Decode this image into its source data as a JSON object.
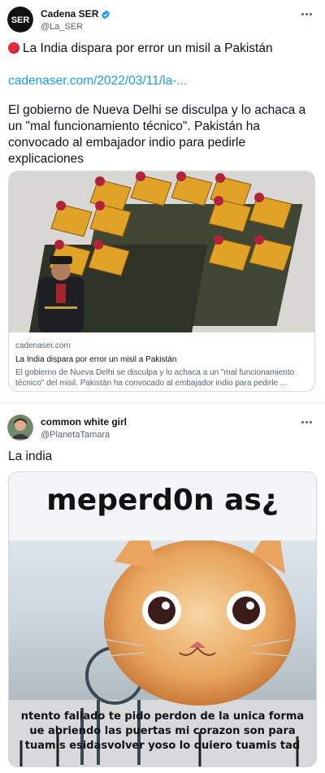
{
  "tweet1": {
    "author_name": "Cadena SER",
    "author_handle": "@La_SER",
    "avatar_text": "SER",
    "headline": "La India dispara por error un misil a Pakistán",
    "link": "cadenaser.com/2022/03/11/la-...",
    "body": "El gobierno de Nueva Delhi se disculpa y lo achaca a un \"mal funcionamiento técnico\". Pakistán ha convocado al embajador indio para pedirle explicaciones",
    "card": {
      "domain": "cadenaser.com",
      "title": "La India dispara por error un misil a Pakistán",
      "description_1": "El gobierno de Nueva Delhi se disculpa y lo achaca a un \"mal funcionamiento",
      "description_2": "técnico\" del misil. Pakistán ha convocado al embajador indio para pedirle ..."
    }
  },
  "tweet2": {
    "author_name": "common white girl",
    "author_handle": "@PlanetaTamara",
    "body": "La india",
    "meme": {
      "title": "meperd0n as¿",
      "caption_1": "ntento fallado te pido perdon de la unica forma",
      "caption_2": "ue abriendo las puertas mi corazon son para",
      "caption_3": "tuamis  esidasvolver  yoso lo quiero tuamis tad"
    }
  },
  "colors": {
    "link": "#1d9bf0",
    "verified": "#1d9bf0",
    "secondary_text": "#536471",
    "alert_dot": "#e8293f"
  }
}
